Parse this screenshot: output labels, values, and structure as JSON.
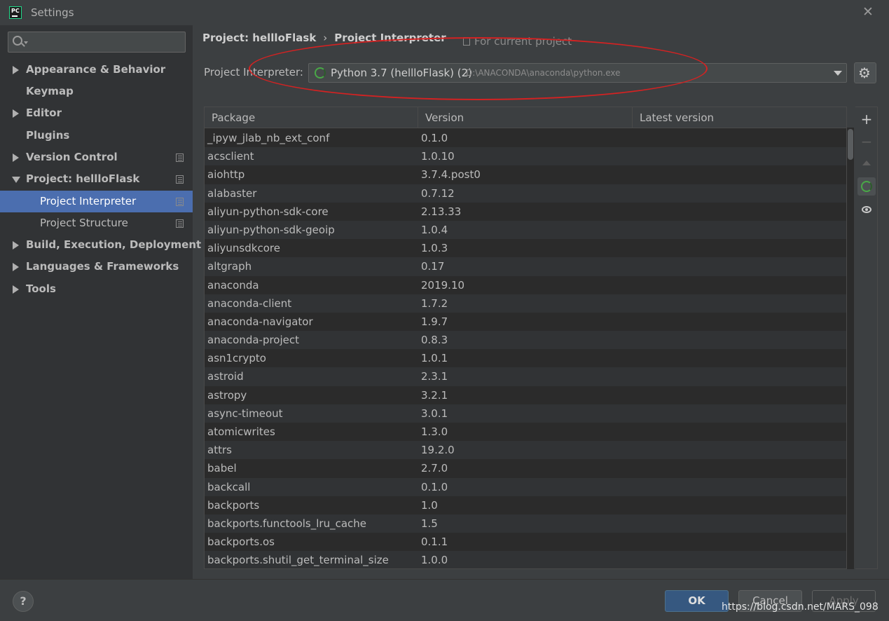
{
  "window": {
    "title": "Settings",
    "close_glyph": "✕"
  },
  "search": {
    "value": "",
    "placeholder": ""
  },
  "sidebar": {
    "items": [
      {
        "label": "Appearance & Behavior"
      },
      {
        "label": "Keymap"
      },
      {
        "label": "Editor"
      },
      {
        "label": "Plugins"
      },
      {
        "label": "Version Control"
      },
      {
        "label": "Project: hellloFlask"
      },
      {
        "label": "Project Interpreter"
      },
      {
        "label": "Project Structure"
      },
      {
        "label": "Build, Execution, Deployment"
      },
      {
        "label": "Languages & Frameworks"
      },
      {
        "label": "Tools"
      }
    ]
  },
  "breadcrumb": {
    "project": "Project: hellloFlask",
    "separator": "›",
    "page": "Project Interpreter"
  },
  "for_current_project": "For current project",
  "interpreter": {
    "label": "Project Interpreter:",
    "name": "Python 3.7 (hellloFlask) (2)",
    "path": "D:\\ANACONDA\\anaconda\\python.exe"
  },
  "table": {
    "headers": [
      "Package",
      "Version",
      "Latest version"
    ],
    "rows": [
      {
        "package": "_ipyw_jlab_nb_ext_conf",
        "version": "0.1.0",
        "latest": ""
      },
      {
        "package": "acsclient",
        "version": "1.0.10",
        "latest": ""
      },
      {
        "package": "aiohttp",
        "version": "3.7.4.post0",
        "latest": ""
      },
      {
        "package": "alabaster",
        "version": "0.7.12",
        "latest": ""
      },
      {
        "package": "aliyun-python-sdk-core",
        "version": "2.13.33",
        "latest": ""
      },
      {
        "package": "aliyun-python-sdk-geoip",
        "version": "1.0.4",
        "latest": ""
      },
      {
        "package": "aliyunsdkcore",
        "version": "1.0.3",
        "latest": ""
      },
      {
        "package": "altgraph",
        "version": "0.17",
        "latest": ""
      },
      {
        "package": "anaconda",
        "version": "2019.10",
        "latest": ""
      },
      {
        "package": "anaconda-client",
        "version": "1.7.2",
        "latest": ""
      },
      {
        "package": "anaconda-navigator",
        "version": "1.9.7",
        "latest": ""
      },
      {
        "package": "anaconda-project",
        "version": "0.8.3",
        "latest": ""
      },
      {
        "package": "asn1crypto",
        "version": "1.0.1",
        "latest": ""
      },
      {
        "package": "astroid",
        "version": "2.3.1",
        "latest": ""
      },
      {
        "package": "astropy",
        "version": "3.2.1",
        "latest": ""
      },
      {
        "package": "async-timeout",
        "version": "3.0.1",
        "latest": ""
      },
      {
        "package": "atomicwrites",
        "version": "1.3.0",
        "latest": ""
      },
      {
        "package": "attrs",
        "version": "19.2.0",
        "latest": ""
      },
      {
        "package": "babel",
        "version": "2.7.0",
        "latest": ""
      },
      {
        "package": "backcall",
        "version": "0.1.0",
        "latest": ""
      },
      {
        "package": "backports",
        "version": "1.0",
        "latest": ""
      },
      {
        "package": "backports.functools_lru_cache",
        "version": "1.5",
        "latest": ""
      },
      {
        "package": "backports.os",
        "version": "0.1.1",
        "latest": ""
      },
      {
        "package": "backports.shutil_get_terminal_size",
        "version": "1.0.0",
        "latest": ""
      }
    ]
  },
  "tools": {
    "add": "+",
    "remove": "−"
  },
  "buttons": {
    "help": "?",
    "ok": "OK",
    "cancel": "Cancel",
    "apply": "Apply"
  },
  "watermark": "https://blog.csdn.net/MARS_098",
  "colors": {
    "accent": "#4b6eaf",
    "ok_button": "#365880",
    "annotation": "#d42222",
    "loading": "#49a847"
  },
  "icons": {
    "app": "pycharm-logo-icon",
    "search": "search-icon",
    "settings": "gear-icon",
    "copy": "project-scope-icon",
    "refresh": "loading-spinner-icon",
    "eye": "eye-icon"
  }
}
